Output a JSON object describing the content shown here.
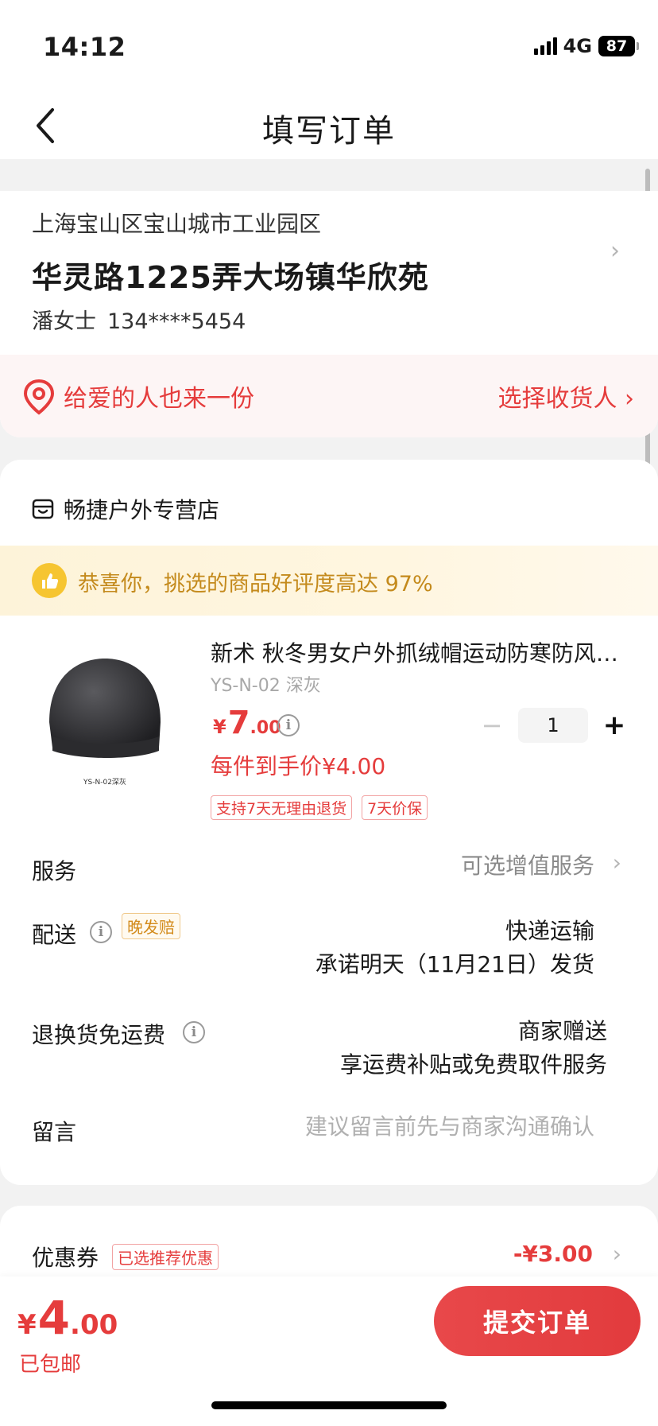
{
  "status_bar": {
    "time": "14:12",
    "network": "4G",
    "battery": "87"
  },
  "nav": {
    "title": "填写订单"
  },
  "address": {
    "region": "上海宝山区宝山城市工业园区",
    "detail": "华灵路1225弄大场镇华欣苑",
    "name": "潘女士",
    "phone": "134****5454"
  },
  "gift": {
    "text": "给爱的人也来一份",
    "action": "选择收货人 ›"
  },
  "shop": {
    "name": "畅捷户外专营店"
  },
  "praise": {
    "text": "恭喜你，挑选的商品好评度高达 97%"
  },
  "product": {
    "title": "新术 秋冬男女户外抓绒帽运动防寒防风保暖帽",
    "sku": "YS-N-02 深灰",
    "image_caption": "YS-N-02深灰",
    "price_symbol": "¥",
    "price_int": "7",
    "price_dec": ".00",
    "unit_price": "每件到手价¥4.00",
    "quantity": "1",
    "tags": [
      "支持7天无理由退货",
      "7天价保"
    ]
  },
  "rows": {
    "service": {
      "label": "服务",
      "value": "可选增值服务"
    },
    "delivery": {
      "label": "配送",
      "badge": "晚发赔",
      "line1": "快递运输",
      "line2": "承诺明天（11月21日）发货"
    },
    "return": {
      "label": "退换货免运费",
      "line1": "商家赠送",
      "line2": "享运费补贴或免费取件服务"
    },
    "message": {
      "label": "留言",
      "placeholder": "建议留言前先与商家沟通确认"
    }
  },
  "coupon": {
    "label": "优惠券",
    "badge": "已选推荐优惠",
    "value": "-¥3.00"
  },
  "bottom": {
    "total_symbol": "¥",
    "total_int": "4",
    "total_dec": ".00",
    "shipping": "已包邮",
    "submit": "提交订单"
  },
  "colors": {
    "accent": "#e53c3c",
    "praise": "#c48a1c",
    "badge_orange": "#d38b1c"
  }
}
